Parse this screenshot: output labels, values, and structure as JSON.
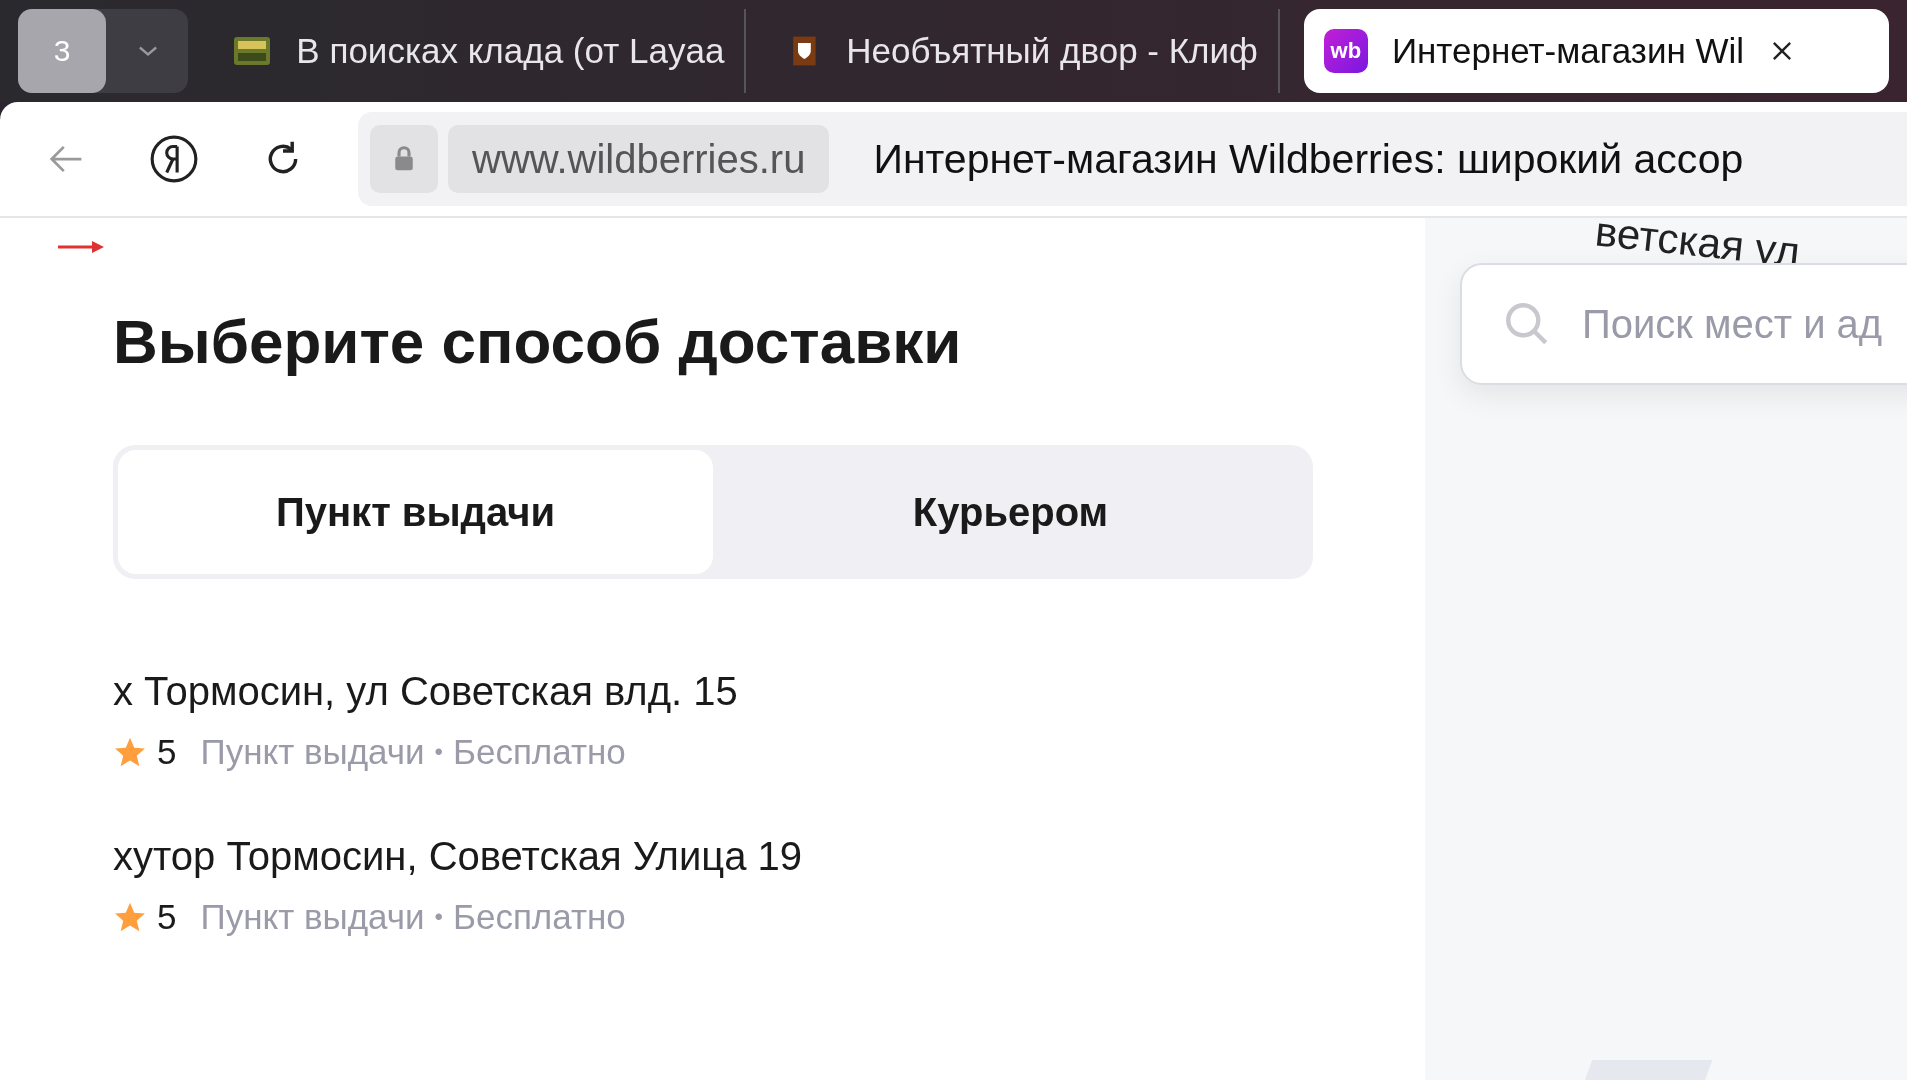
{
  "browser": {
    "tab_count": "3",
    "tabs": [
      {
        "title": "В поисках клада (от Layaa",
        "kind": "game",
        "selected": false
      },
      {
        "title": "Необъятный двор - Клиф",
        "kind": "shield",
        "selected": false
      },
      {
        "title": "Интернет-магазин Wil",
        "kind": "wb",
        "favicon_text": "wb",
        "selected": true
      }
    ],
    "address": "www.wildberries.ru",
    "page_title": "Интернет-магазин Wildberries: широкий ассор"
  },
  "panel": {
    "heading": "Выберите способ доставки",
    "delivery_tabs": [
      {
        "label": "Пункт выдачи",
        "selected": true
      },
      {
        "label": "Курьером",
        "selected": false
      }
    ],
    "points": [
      {
        "address": "х Тормосин, ул Советская влд. 15",
        "rating": "5",
        "type": "Пункт выдачи",
        "separator": "•",
        "price": "Бесплатно"
      },
      {
        "address": "хутор Тормосин, Советская Улица 19",
        "rating": "5",
        "type": "Пункт выдачи",
        "separator": "•",
        "price": "Бесплатно"
      }
    ]
  },
  "map": {
    "street_label": "ветская ул",
    "search": {
      "placeholder": "Поиск мест и ад"
    }
  }
}
